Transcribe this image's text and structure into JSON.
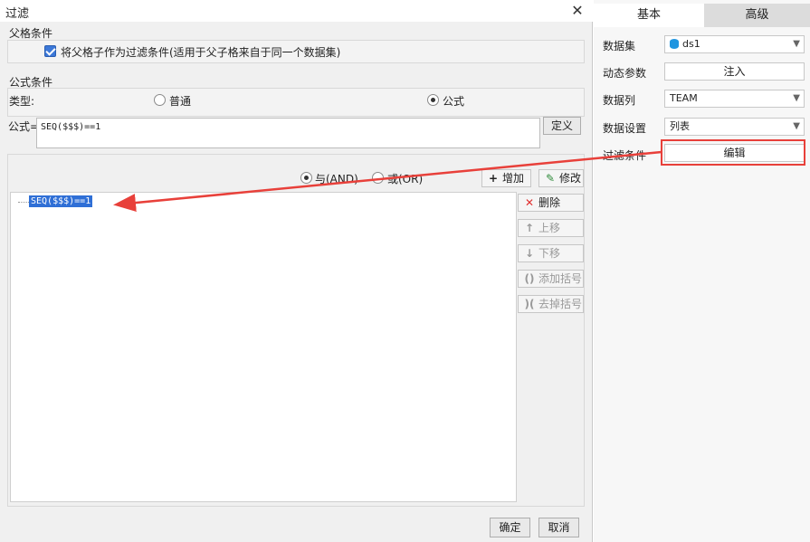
{
  "dialog": {
    "title": "过滤",
    "close_label": "✕",
    "parent_group": {
      "title": "父格条件",
      "checkbox_label": "将父格子作为过滤条件(适用于父子格来自于同一个数据集)"
    },
    "formula_group": {
      "title": "公式条件",
      "type_label": "类型:",
      "type_options": [
        "普通",
        "公式"
      ],
      "formula_label": "公式=",
      "formula_value": "SEQ($$$)==1",
      "define_button": "定义"
    },
    "logic": {
      "and_label": "与(AND)",
      "or_label": "或(OR)"
    },
    "toolbar": {
      "add": "增加",
      "modify": "修改",
      "delete": "删除",
      "move_up": "上移",
      "move_down": "下移",
      "add_brackets": "添加括号",
      "remove_brackets": "去掉括号"
    },
    "conditions": [
      "SEQ($$$)==1"
    ],
    "ok": "确定",
    "cancel": "取消"
  },
  "panel": {
    "tabs": [
      "基本",
      "高级"
    ],
    "dataset_label": "数据集",
    "dataset_value": "ds1",
    "dynamic_param_label": "动态参数",
    "inject_button": "注入",
    "data_column_label": "数据列",
    "data_column_value": "TEAM",
    "data_setting_label": "数据设置",
    "data_setting_value": "列表",
    "filter_label": "过滤条件",
    "edit_button": "编辑"
  },
  "colors": {
    "annotation": "#e8403a",
    "selection": "#2f6fd6",
    "checkbox": "#3c78d8"
  }
}
